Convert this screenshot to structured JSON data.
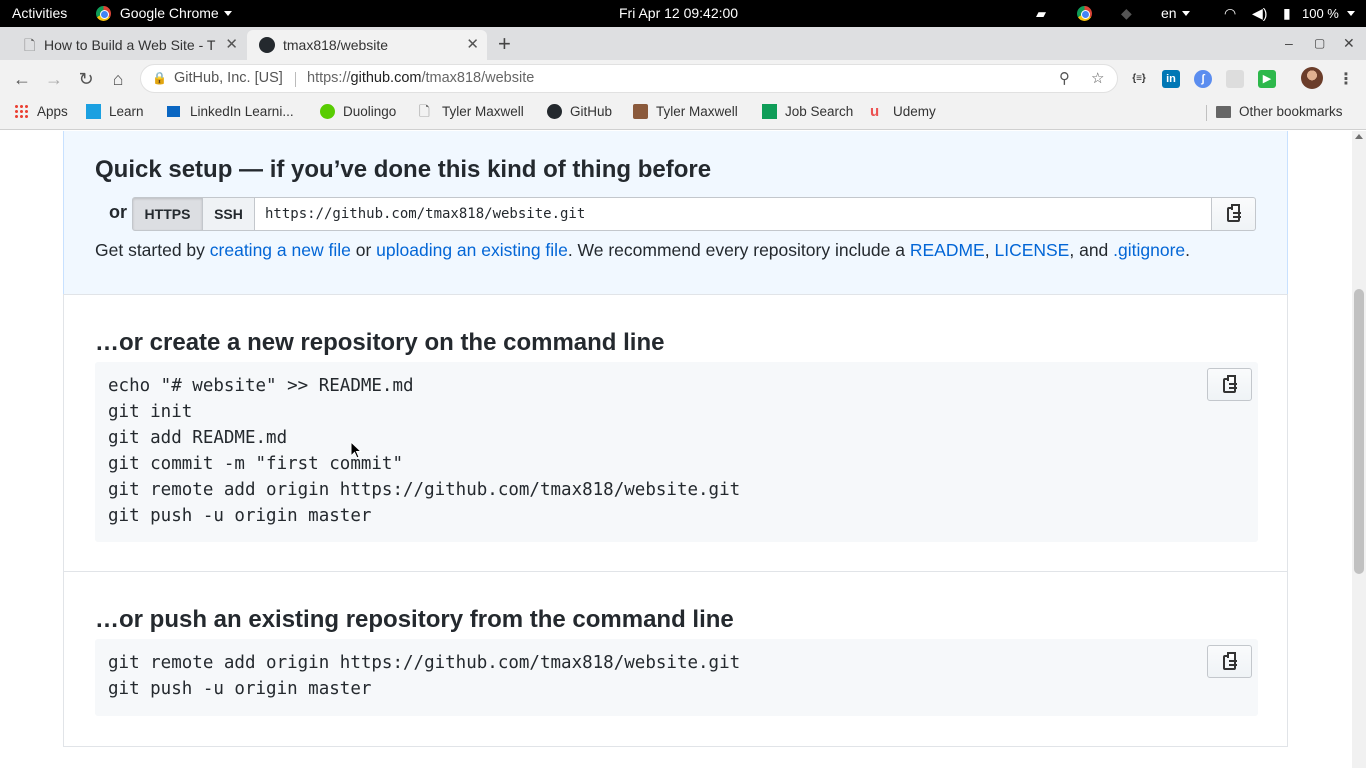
{
  "system_bar": {
    "activities": "Activities",
    "app_name": "Google Chrome",
    "clock": "Fri Apr 12  09:42:00",
    "language": "en",
    "battery": "100 %"
  },
  "tabs": [
    {
      "title": "How to Build a Web Site - T",
      "active": false
    },
    {
      "title": "tmax818/website",
      "active": true
    }
  ],
  "omnibox": {
    "security_label": "GitHub, Inc. [US]",
    "url_prefix": "https://",
    "url_host": "github.com",
    "url_path": "/tmax818/website"
  },
  "bookmarks": [
    {
      "label": "Apps",
      "icon": "apps-grid-icon"
    },
    {
      "label": "Learn",
      "icon": "learn-icon"
    },
    {
      "label": "LinkedIn Learni...",
      "icon": "linkedin-learning-icon"
    },
    {
      "label": "Duolingo",
      "icon": "duolingo-icon"
    },
    {
      "label": "Tyler Maxwell",
      "icon": "page-icon"
    },
    {
      "label": "GitHub",
      "icon": "github-icon"
    },
    {
      "label": "Tyler Maxwell",
      "icon": "avatar-icon"
    },
    {
      "label": "Job Search",
      "icon": "sheets-icon"
    },
    {
      "label": "Udemy",
      "icon": "udemy-icon"
    }
  ],
  "other_bookmarks": "Other bookmarks",
  "quick_setup": {
    "title": "Quick setup — if you’ve done this kind of thing before",
    "or_label": "or",
    "https_label": "HTTPS",
    "ssh_label": "SSH",
    "clone_url": "https://github.com/tmax818/website.git",
    "get_started": {
      "t1": "Get started by ",
      "link_new_file": "creating a new file",
      "t2": " or ",
      "link_upload": "uploading an existing file",
      "t3": ". We recommend every repository include a ",
      "link_readme": "README",
      "t4": ", ",
      "link_license": "LICENSE",
      "t5": ", and ",
      "link_gitignore": ".gitignore",
      "t6": "."
    }
  },
  "new_repo": {
    "title": "…or create a new repository on the command line",
    "lines": [
      "echo \"# website\" >> README.md",
      "git init",
      "git add README.md",
      "git commit -m \"first commit\"",
      "git remote add origin https://github.com/tmax818/website.git",
      "git push -u origin master"
    ]
  },
  "push_repo": {
    "title": "…or push an existing repository from the command line",
    "lines": [
      "git remote add origin https://github.com/tmax818/website.git",
      "git push -u origin master"
    ]
  },
  "colors": {
    "link": "#0366d6",
    "quick_setup_bg": "#f1f8ff",
    "code_bg": "#f6f8fa"
  }
}
